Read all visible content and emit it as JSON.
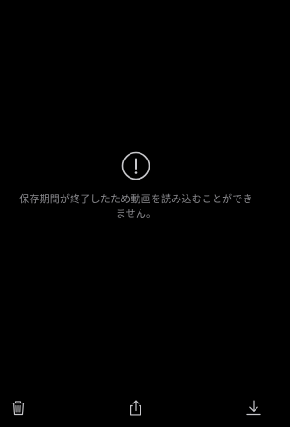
{
  "error": {
    "icon": "exclamation-circle-icon",
    "message": "保存期間が終了したため動画を読み込むことができません。"
  },
  "toolbar": {
    "delete_icon": "trash-icon",
    "share_icon": "share-icon",
    "download_icon": "download-icon"
  },
  "colors": {
    "background": "#000000",
    "icon": "#c8c8cc",
    "message_text": "#8a8a8e"
  }
}
